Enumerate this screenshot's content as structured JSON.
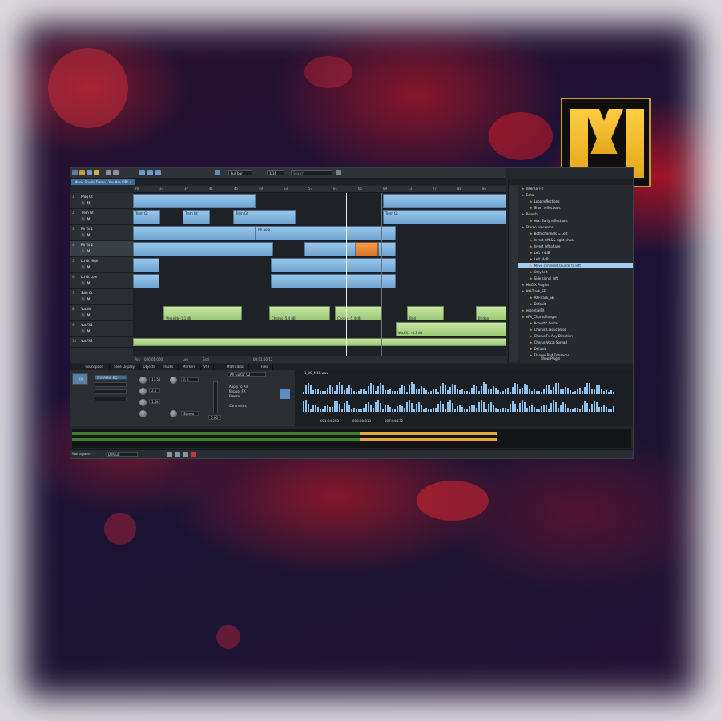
{
  "toolbar": {
    "zoom": "Full bar",
    "grid": "1/16",
    "search_placeholder": "Search"
  },
  "project_tab": "Music Studio Demo - You Are VIP* ×",
  "ruler_marks": [
    "29",
    "33",
    "37",
    "41",
    "45",
    "49",
    "53",
    "57",
    "61",
    "65",
    "69",
    "73",
    "77",
    "81",
    "85"
  ],
  "tracks": [
    {
      "n": "1",
      "name": "Prog Gt"
    },
    {
      "n": "2",
      "name": "Trem Gt"
    },
    {
      "n": "3",
      "name": "Rh Gt 1"
    },
    {
      "n": "4",
      "name": "Rh Gt 2"
    },
    {
      "n": "5",
      "name": "Ld Gt High"
    },
    {
      "n": "6",
      "name": "Ld Gt Low"
    },
    {
      "n": "7",
      "name": "Solo Gt"
    },
    {
      "n": "8",
      "name": "Vocals"
    },
    {
      "n": "9",
      "name": "VocFX1"
    },
    {
      "n": "10",
      "name": "VocFX2"
    }
  ],
  "clips": {
    "trem": "Trem Gt",
    "rhsolo": "Rh Solo",
    "verse": "Verse2b  -1.1 dB",
    "chorus1": "Chorus  -5.4 dB",
    "chorus2": "Chorus  -5.4 dB",
    "brid": "Brid",
    "bridge": "Bridge",
    "vocfx": "VocFX1  -3.3 dB"
  },
  "arranger_status": {
    "pos_label": "Pos",
    "pos": "046:01:000",
    "len_label": "Len",
    "end_label": "End",
    "time": "00:01:50:12"
  },
  "browser": {
    "items": [
      {
        "text": "Internal FX",
        "type": "folder"
      },
      {
        "text": "Echo",
        "type": "folder"
      },
      {
        "text": "Loop reflections",
        "type": "preset"
      },
      {
        "text": "Short reflections",
        "type": "preset"
      },
      {
        "text": "Reverb",
        "type": "folder"
      },
      {
        "text": "Vox: Early reflections",
        "type": "preset"
      },
      {
        "text": "Stereo processor",
        "type": "folder"
      },
      {
        "text": "Both channels = Left",
        "type": "preset"
      },
      {
        "text": "Invert left && right phase",
        "type": "preset"
      },
      {
        "text": "Invert left phase",
        "type": "preset"
      },
      {
        "text": "Left +4dB",
        "type": "preset"
      },
      {
        "text": "Left -4dB",
        "type": "preset"
      },
      {
        "text": "Move centered sounds to left",
        "type": "preset",
        "selected": true
      },
      {
        "text": "Only left",
        "type": "preset"
      },
      {
        "text": "Side signal left",
        "type": "preset"
      },
      {
        "text": "MAGIX Plugins",
        "type": "folder"
      },
      {
        "text": "AM-Track_SE",
        "type": "folder"
      },
      {
        "text": "AM-Track_SE",
        "type": "preset"
      },
      {
        "text": "Default",
        "type": "preset"
      },
      {
        "text": "essentialFX",
        "type": "folder"
      },
      {
        "text": "eFX_ChorusFlanger",
        "type": "folder"
      },
      {
        "text": "Acoustic Guitar",
        "type": "preset"
      },
      {
        "text": "Chorus Classic Bass",
        "type": "preset"
      },
      {
        "text": "Chorus Fx Any Direction",
        "type": "preset"
      },
      {
        "text": "Chorus Vocal Spread",
        "type": "preset"
      },
      {
        "text": "Default",
        "type": "preset"
      },
      {
        "text": "Flanger Pad Enhancer",
        "type": "preset"
      }
    ],
    "footer": "Show Plugin"
  },
  "lower_tabs": [
    "Soundpool",
    "Slide Display",
    "Objects",
    "Tracks",
    "Markers",
    "VST",
    "MIDI Editor",
    "Files"
  ],
  "mixer": {
    "fx_label": "FX",
    "eq_label": "DYNAMIC EQ",
    "preset": "Ah Guitar 02",
    "apply_label": "Apply to All",
    "bypass_label": "Bypass FX",
    "freeze_label": "Freeze",
    "comment_label": "Comments",
    "stereo_label": "Stereo",
    "values": [
      "13.5k",
      "2.0",
      "1.0k",
      "0.0",
      "0.00"
    ]
  },
  "editor": {
    "title": "1_00_M10.wav",
    "pos": "001:04:203",
    "len": "008:00:013",
    "end": "007:04:172"
  },
  "workspace": {
    "label": "Workspace:",
    "value": "Default"
  },
  "logo": {
    "brand_colors": {
      "gold": "#ffcd43",
      "frame": "#c79a2c"
    }
  }
}
